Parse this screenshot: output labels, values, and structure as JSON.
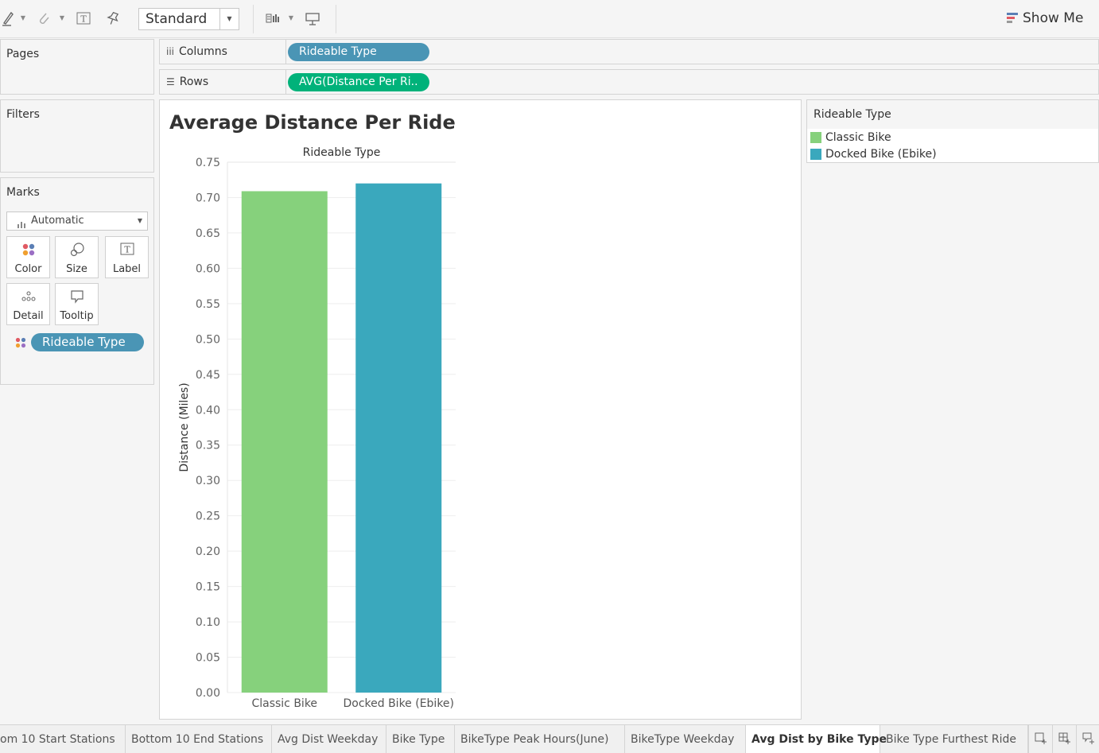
{
  "toolbar": {
    "mode_select": "Standard",
    "show_me_label": "Show Me",
    "icons": [
      "highlighter-icon",
      "paperclip-icon",
      "text-icon",
      "pin-icon",
      "fit-icon",
      "presentation-icon"
    ]
  },
  "shelves": {
    "pages_title": "Pages",
    "filters_title": "Filters",
    "columns_label": "Columns",
    "rows_label": "Rows",
    "columns_pill": "Rideable Type",
    "rows_pill": "AVG(Distance Per Ri.."
  },
  "marks": {
    "title": "Marks",
    "type": "Automatic",
    "buttons": [
      "Color",
      "Size",
      "Label",
      "Detail",
      "Tooltip"
    ],
    "color_pill": "Rideable Type"
  },
  "legend": {
    "title": "Rideable Type",
    "items": [
      {
        "label": "Classic Bike",
        "color": "#86d17c"
      },
      {
        "label": "Docked Bike (Ebike)",
        "color": "#3aa8bd"
      }
    ]
  },
  "chart_data": {
    "type": "bar",
    "title": "Average Distance Per Ride",
    "column_header": "Rideable Type",
    "ylabel": "Distance (Miles)",
    "categories": [
      "Classic Bike",
      "Docked Bike (Ebike)"
    ],
    "values": [
      0.709,
      0.72
    ],
    "colors": [
      "#86d17c",
      "#3aa8bd"
    ],
    "ylim": [
      0,
      0.75
    ],
    "yticks": [
      "0.00",
      "0.05",
      "0.10",
      "0.15",
      "0.20",
      "0.25",
      "0.30",
      "0.35",
      "0.40",
      "0.45",
      "0.50",
      "0.55",
      "0.60",
      "0.65",
      "0.70",
      "0.75"
    ],
    "grid": true
  },
  "tabs": [
    {
      "label": "om 10 Start Stations",
      "active": false
    },
    {
      "label": "Bottom 10 End Stations",
      "active": false
    },
    {
      "label": "Avg Dist Weekday",
      "active": false
    },
    {
      "label": "Bike Type",
      "active": false
    },
    {
      "label": "BikeType Peak Hours(June)",
      "active": false
    },
    {
      "label": "BikeType Weekday",
      "active": false
    },
    {
      "label": "Avg Dist by Bike Type",
      "active": true
    },
    {
      "label": "Bike Type Furthest Ride",
      "active": false
    }
  ]
}
